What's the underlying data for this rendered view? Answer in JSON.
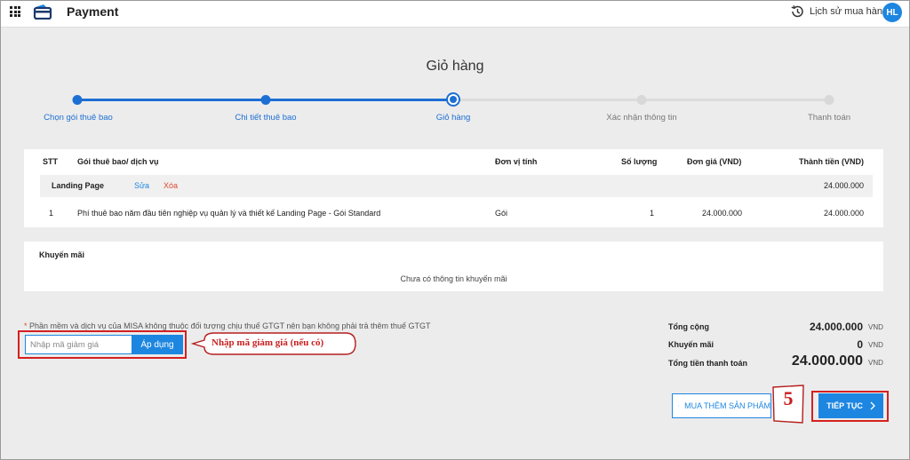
{
  "header": {
    "app_title": "Payment",
    "history_label": "Lịch sử mua hàng",
    "avatar_initials": "HL"
  },
  "page_title": "Giỏ hàng",
  "stepper": {
    "steps": [
      {
        "label": "Chọn gói thuê bao",
        "state": "done"
      },
      {
        "label": "Chi tiết thuê bao",
        "state": "done"
      },
      {
        "label": "Giỏ hàng",
        "state": "active"
      },
      {
        "label": "Xác nhận thông tin",
        "state": "pending"
      },
      {
        "label": "Thanh toán",
        "state": "pending"
      }
    ]
  },
  "cart": {
    "headers": {
      "stt": "STT",
      "package": "Gói thuê bao/ dịch vụ",
      "unit": "Đơn vị tính",
      "quantity": "Số lượng",
      "unit_price": "Đơn giá (VND)",
      "total": "Thành tiền (VND)"
    },
    "group": {
      "name": "Landing Page",
      "edit_label": "Sửa",
      "delete_label": "Xóa",
      "total": "24.000.000"
    },
    "rows": [
      {
        "stt": "1",
        "package": "Phí thuê bao năm đầu tiên nghiệp vụ quản lý và thiết kế Landing Page - Gói Standard",
        "unit": "Gói",
        "quantity": "1",
        "unit_price": "24.000.000",
        "total": "24.000.000"
      }
    ]
  },
  "promotion": {
    "title": "Khuyến mãi",
    "empty_text": "Chưa có thông tin khuyến mãi"
  },
  "tax_note": {
    "star": "*",
    "text": " Phần mềm và dịch vụ của MISA không thuộc đối tượng chịu thuế GTGT nên bạn không phải trả thêm thuế GTGT"
  },
  "coupon": {
    "placeholder": "Nhập mã giảm giá",
    "apply_label": "Áp dụng",
    "callout": "Nhập mã giảm giá (nếu có)"
  },
  "summary": {
    "subtotal_label": "Tổng cộng",
    "subtotal_value": "24.000.000",
    "discount_label": "Khuyến mãi",
    "discount_value": "0",
    "grand_total_label": "Tổng tiền thanh toán",
    "grand_total_value": "24.000.000",
    "currency": "VND"
  },
  "actions": {
    "more_label": "MUA THÊM SẢN PHẨM",
    "step_number": "5",
    "next_label": "TIẾP TỤC"
  },
  "colors": {
    "accent": "#1d86e0",
    "stepper_blue": "#1d6fd3",
    "highlight_red": "#d42020",
    "delete_red": "#e0492d"
  }
}
